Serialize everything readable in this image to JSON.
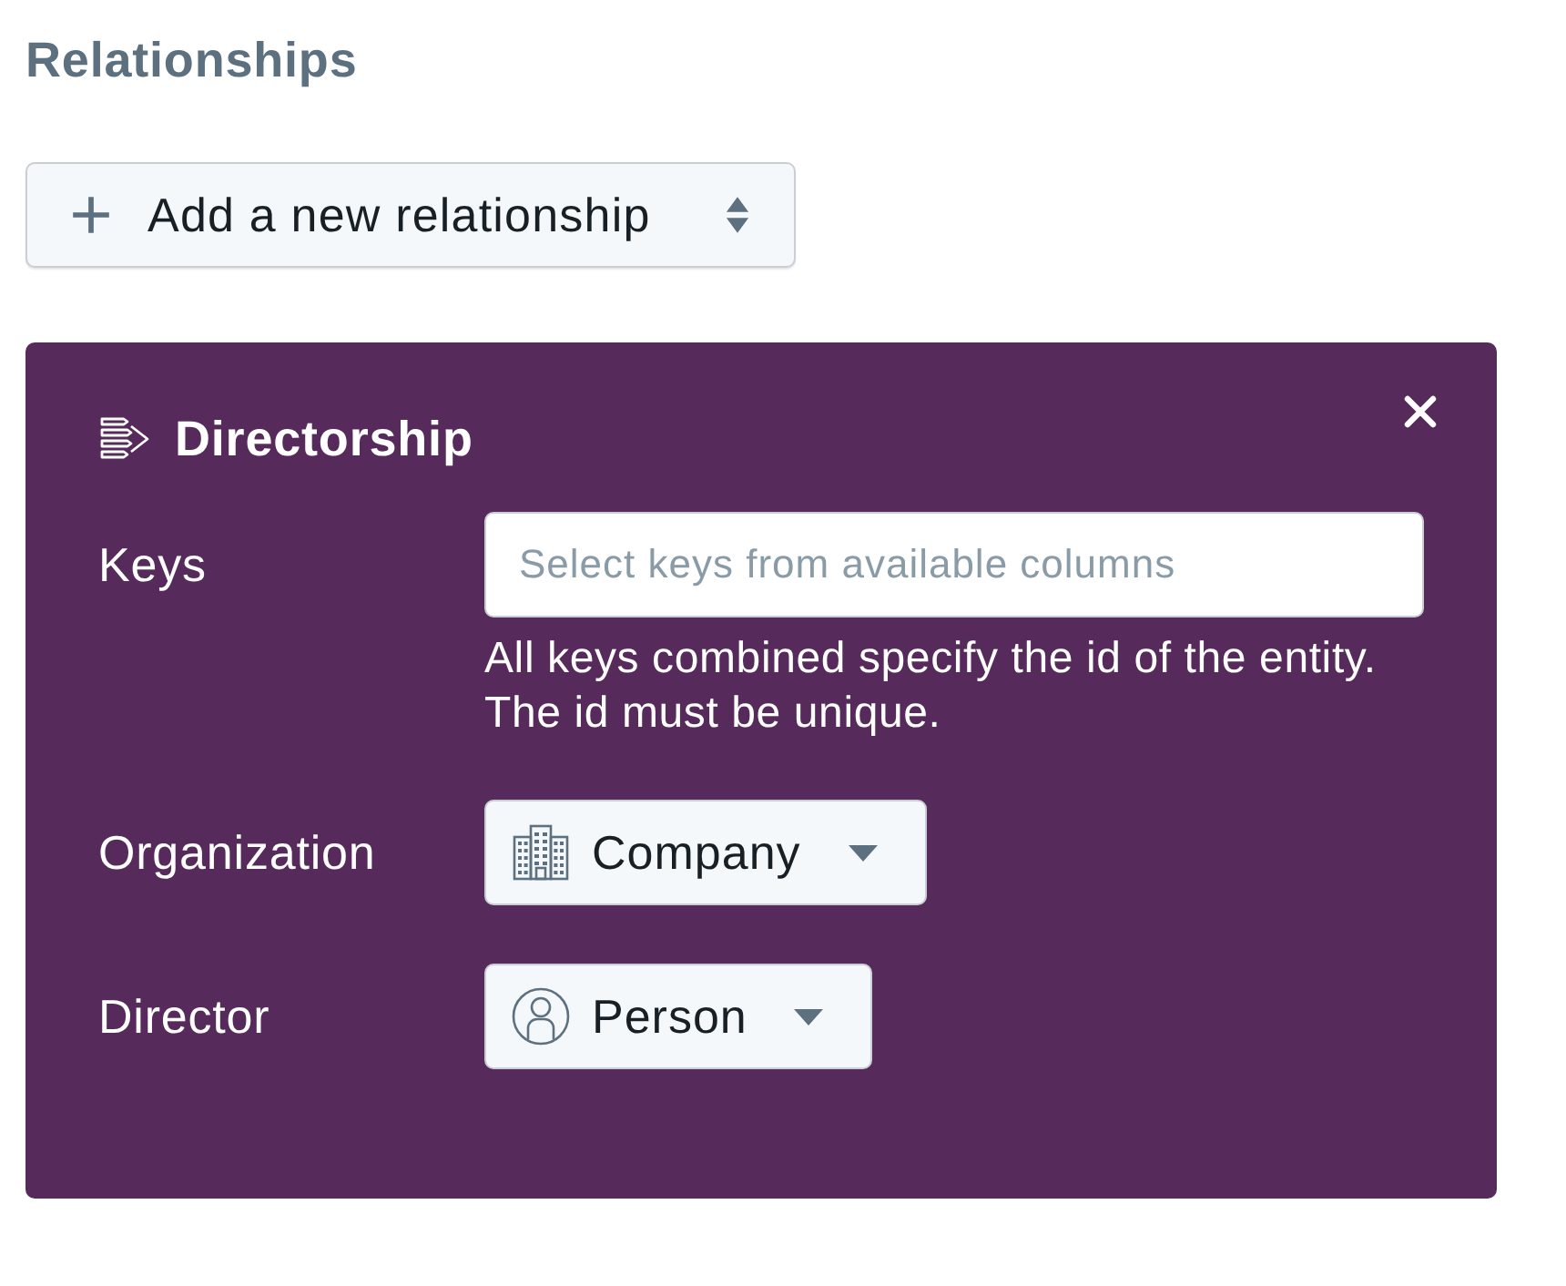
{
  "heading": "Relationships",
  "add_button": {
    "label": "Add a new relationship"
  },
  "panel": {
    "title": "Directorship",
    "fields": [
      {
        "kind": "keys",
        "label": "Keys",
        "placeholder": "Select keys from available columns",
        "help": "All keys combined specify the id of the entity. The id must be unique."
      },
      {
        "kind": "organization",
        "label": "Organization",
        "value": "Company"
      },
      {
        "kind": "person",
        "label": "Director",
        "value": "Person"
      }
    ]
  }
}
